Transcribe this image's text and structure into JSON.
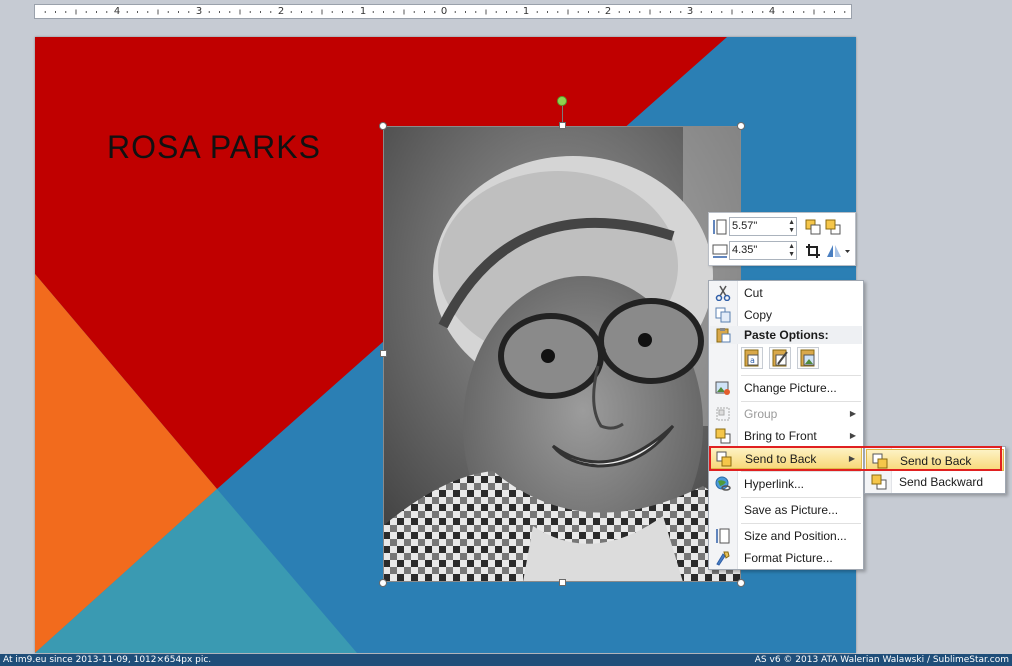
{
  "ruler": {
    "labels": [
      "4",
      "3",
      "2",
      "1",
      "0",
      "1",
      "2",
      "3",
      "4"
    ]
  },
  "slide": {
    "title": "ROSA PARKS",
    "colors": {
      "red": "#c00000",
      "blue": "#2b7fb4",
      "orange": "#f26b1d",
      "teal": "#3a9ab2"
    }
  },
  "mini_toolbar": {
    "height_value": "5.57\"",
    "width_value": "4.35\""
  },
  "context_menu": {
    "items": [
      {
        "label": "Cut",
        "icon": "scissors-icon"
      },
      {
        "label": "Copy",
        "icon": "copy-icon"
      },
      {
        "label": "Paste Options:",
        "icon": "paste-icon"
      },
      {
        "label": "Change Picture...",
        "icon": "change-picture-icon"
      },
      {
        "label": "Group",
        "icon": "group-icon",
        "disabled": true
      },
      {
        "label": "Bring to Front",
        "icon": "bring-to-front-icon"
      },
      {
        "label": "Send to Back",
        "icon": "send-to-back-icon",
        "highlighted": true
      },
      {
        "label": "Hyperlink...",
        "icon": "hyperlink-icon"
      },
      {
        "label": "Save as Picture...",
        "icon": ""
      },
      {
        "label": "Size and Position...",
        "icon": "size-position-icon"
      },
      {
        "label": "Format Picture...",
        "icon": "format-picture-icon"
      }
    ]
  },
  "submenu": {
    "items": [
      {
        "label": "Send to Back",
        "highlighted": true
      },
      {
        "label": "Send Backward"
      }
    ]
  },
  "status": {
    "left": "At im9.eu  since 2013-11-09, 1012×654px pic.",
    "right": "AS v6 © 2013 ATA Walerian Walawski / SublimeStar.com"
  }
}
